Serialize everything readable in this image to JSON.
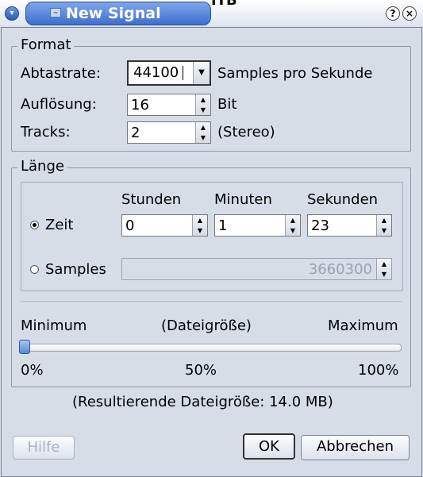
{
  "window": {
    "title": "New Signal",
    "background_text": "ITB"
  },
  "format": {
    "legend": "Format",
    "sample_rate_label": "Abtastrate:",
    "sample_rate_value": "44100",
    "sample_rate_unit": "Samples pro Sekunde",
    "resolution_label": "Auflösung:",
    "resolution_value": "16",
    "resolution_unit": "Bit",
    "tracks_label": "Tracks:",
    "tracks_value": "2",
    "tracks_unit": "(Stereo)"
  },
  "length": {
    "legend": "Länge",
    "hours_header": "Stunden",
    "minutes_header": "Minuten",
    "seconds_header": "Sekunden",
    "time_label": "Zeit",
    "hours_value": "0",
    "minutes_value": "1",
    "seconds_value": "23",
    "samples_label": "Samples",
    "samples_value": "3660300",
    "time_selected": true,
    "slider_min_label": "Minimum",
    "slider_mid_label": "(Dateigröße)",
    "slider_max_label": "Maximum",
    "slider_value_percent": 0,
    "pct_0": "0%",
    "pct_50": "50%",
    "pct_100": "100%"
  },
  "result": "(Resultierende Dateigröße: 14.0 MB)",
  "buttons": {
    "help": "Hilfe",
    "ok": "OK",
    "cancel": "Abbrechen"
  },
  "colors": {
    "title_accent": "#3e6fce",
    "window_bg": "#d7dde7"
  },
  "icons": [
    "window-menu-icon",
    "help-icon",
    "close-icon"
  ]
}
